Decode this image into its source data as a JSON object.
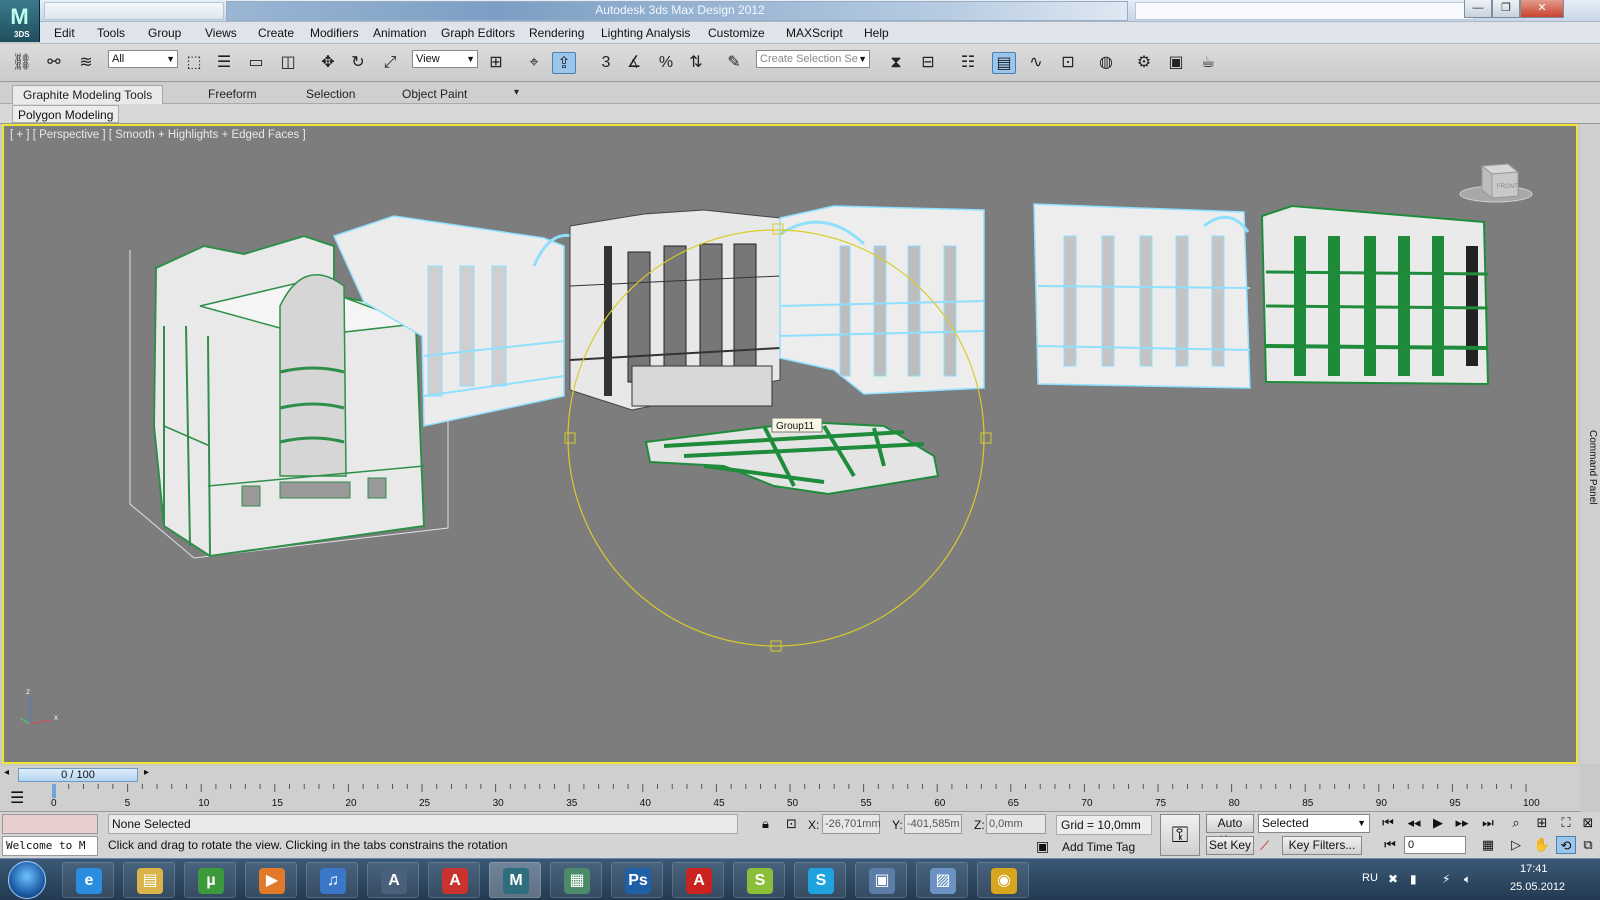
{
  "window": {
    "title": "Autodesk 3ds Max Design 2012",
    "logo_text": "3DS",
    "minimize": "—",
    "maximize": "❐",
    "close": "✕"
  },
  "menu": [
    "Edit",
    "Tools",
    "Group",
    "Views",
    "Create",
    "Modifiers",
    "Animation",
    "Graph Editors",
    "Rendering",
    "Lighting Analysis",
    "Customize",
    "MAXScript",
    "Help"
  ],
  "toolbar": {
    "filter_value": "All",
    "refcoord_value": "View",
    "named_selection_placeholder": "Create Selection Se",
    "snap_label": "3"
  },
  "ribbon": {
    "tabs": [
      "Graphite Modeling Tools",
      "Freeform",
      "Selection",
      "Object Paint"
    ],
    "active_tab": 0,
    "panel_label": "Polygon Modeling"
  },
  "viewport": {
    "label": "[ + ] [ Perspective ] [ Smooth + Highlights + Edged Faces ]",
    "tooltip": "Group11",
    "viewcube_label": "FRONT",
    "axis_z": "z",
    "axis_x": "x",
    "accent_border": "#f0e332",
    "selection_wire": "#3ba35a",
    "frozen_wire": "#8fe0ff"
  },
  "command_panel": {
    "label": "Command Panel"
  },
  "time_slider": {
    "value": "0 / 100"
  },
  "trackbar": {
    "ticks": [
      "0",
      "5",
      "10",
      "15",
      "20",
      "25",
      "30",
      "35",
      "40",
      "45",
      "50",
      "55",
      "60",
      "65",
      "70",
      "75",
      "80",
      "85",
      "90",
      "95",
      "100"
    ]
  },
  "status": {
    "maxscript_text": "Welcome to M",
    "selection": "None Selected",
    "prompt": "Click and drag to rotate the view.  Clicking in the tabs constrains the rotation",
    "x_label": "X:",
    "x_value": "-26,701mm",
    "y_label": "Y:",
    "y_value": "-401,585m",
    "z_label": "Z:",
    "z_value": "0,0mm",
    "grid": "Grid = 10,0mm",
    "add_time_tag": "Add Time Tag",
    "auto_key": "Auto Key",
    "set_key": "Set Key",
    "selected_dropdown": "Selected",
    "key_filters": "Key Filters...",
    "frame_value": "0"
  },
  "taskbar": {
    "lang": "RU",
    "time": "17:41",
    "date": "25.05.2012",
    "apps": [
      {
        "name": "internet-explorer",
        "glyph": "e",
        "color": "#2a8de0"
      },
      {
        "name": "file-explorer",
        "glyph": "▤",
        "color": "#d9b44a"
      },
      {
        "name": "utorrent",
        "glyph": "µ",
        "color": "#3c9a3c"
      },
      {
        "name": "media-player",
        "glyph": "▶",
        "color": "#e07a2a"
      },
      {
        "name": "itunes",
        "glyph": "♫",
        "color": "#3b77c9"
      },
      {
        "name": "autocad-architecture",
        "glyph": "A",
        "color": "#4a5f7a"
      },
      {
        "name": "autocad",
        "glyph": "A",
        "color": "#c8332d"
      },
      {
        "name": "3ds-max",
        "glyph": "M",
        "color": "#2e6d7d"
      },
      {
        "name": "presentation",
        "glyph": "▦",
        "color": "#4d8a6a"
      },
      {
        "name": "photoshop",
        "glyph": "Ps",
        "color": "#1f5fa8"
      },
      {
        "name": "acrobat",
        "glyph": "A",
        "color": "#c8231f"
      },
      {
        "name": "sketch-app",
        "glyph": "S",
        "color": "#8bbf3a"
      },
      {
        "name": "skype",
        "glyph": "S",
        "color": "#1fa3e0"
      },
      {
        "name": "remote-desktop",
        "glyph": "▣",
        "color": "#5b7da6"
      },
      {
        "name": "photo-viewer",
        "glyph": "▨",
        "color": "#6b92c2"
      },
      {
        "name": "chrome",
        "glyph": "◉",
        "color": "#d6a61f"
      }
    ]
  }
}
